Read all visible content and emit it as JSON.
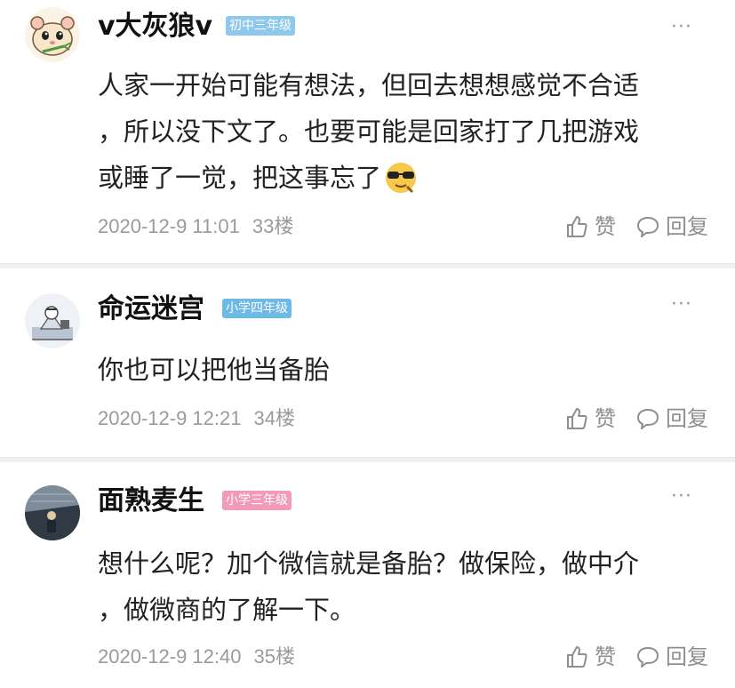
{
  "comments": [
    {
      "username": "v大灰狼v",
      "badge": "初中三年级",
      "badge_color": "#8ec9ec",
      "avatar_icon": "hamster-avatar",
      "text_lines": [
        "人家一开始可能有想法，但回去想想感觉不合适",
        "，所以没下文了。也要可能是回家打了几把游戏",
        "或睡了一觉，把这事忘了"
      ],
      "emoji": "sunglasses-emoji",
      "date": "2020-12-9 11:01",
      "floor": "33楼",
      "like_label": "赞",
      "reply_label": "回复",
      "more": "···"
    },
    {
      "username": "命运迷宫",
      "badge": "小学四年级",
      "badge_color": "#6fb9e6",
      "avatar_icon": "sketch-avatar",
      "text_lines": [
        "你也可以把他当备胎"
      ],
      "date": "2020-12-9 12:21",
      "floor": "34楼",
      "like_label": "赞",
      "reply_label": "回复",
      "more": "···"
    },
    {
      "username": "面熟麦生",
      "badge": "小学三年级",
      "badge_color": "#f39ab8",
      "avatar_icon": "photo-avatar",
      "text_lines": [
        "想什么呢？加个微信就是备胎？做保险，做中介",
        "，做微商的了解一下。"
      ],
      "date": "2020-12-9 12:40",
      "floor": "35楼",
      "like_label": "赞",
      "reply_label": "回复",
      "more": "···"
    }
  ]
}
